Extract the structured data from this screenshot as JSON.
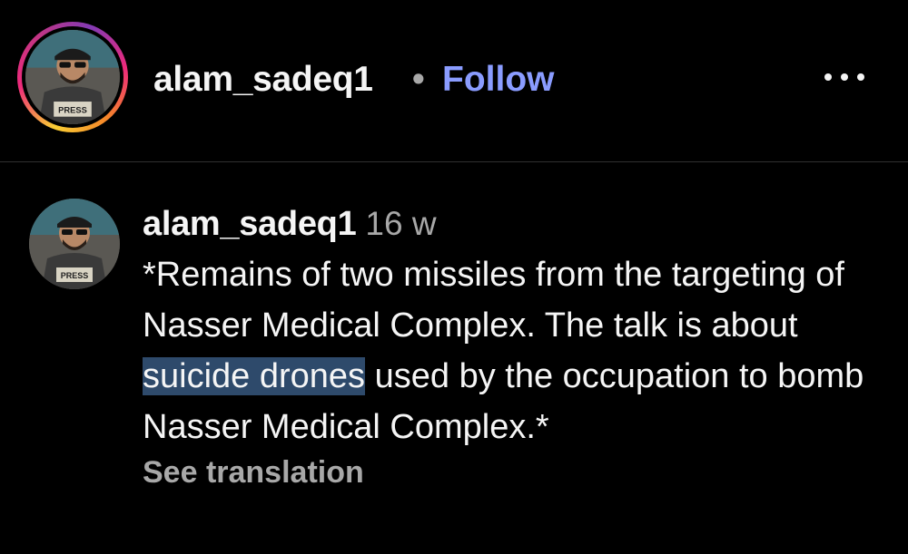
{
  "header": {
    "username": "alam_sadeq1",
    "separator": "•",
    "follow_label": "Follow",
    "avatar_badge_text": "PRESS",
    "more_icon": "more-horizontal-icon"
  },
  "comment": {
    "username": "alam_sadeq1",
    "time_ago": "16 w",
    "text_before": "*Remains of two missiles from the targeting of Nasser Medical Complex. The talk is about ",
    "text_highlighted": "suicide drones",
    "text_after": " used by the occupation to bomb Nasser Medical Complex.*",
    "see_translation_label": "See translation",
    "avatar_badge_text": "PRESS"
  },
  "colors": {
    "background": "#000000",
    "follow_link": "#8a9cff",
    "muted_text": "#a8a8a8",
    "selection_highlight": "#2e4a6b"
  }
}
